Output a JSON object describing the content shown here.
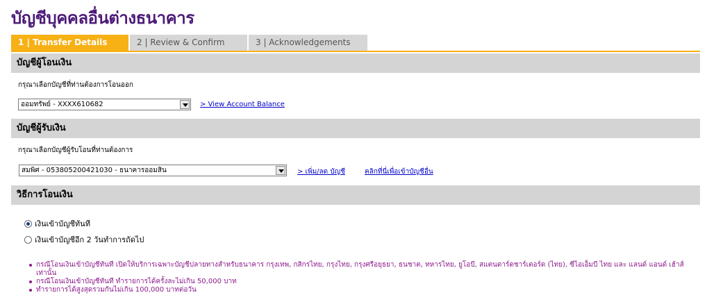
{
  "page": {
    "title": "บัญชีบุคคลอื่นต่างธนาคาร"
  },
  "tabs": [
    {
      "label": "1 | Transfer Details"
    },
    {
      "label": "2 | Review & Confirm"
    },
    {
      "label": "3 | Acknowledgements"
    }
  ],
  "from_account": {
    "header": "บัญชีผู้โอนเงิน",
    "instruction": "กรุณาเลือกบัญชีที่ท่านต้องการโอนออก",
    "selected": "ออมทรัพย์ - XXXX610682",
    "balance_link": "> View Account Balance"
  },
  "to_account": {
    "header": "บัญชีผู้รับเงิน",
    "instruction": "กรุณาเลือกบัญชีผู้รับโอนที่ท่านต้องการ",
    "selected": "สมพิศ - 053805200421030 - ธนาคารออมสิน",
    "add_remove_link": "> เพิ่ม/ลด บัญชี",
    "click_link": "คลิกที่นี่เพื่อเข้าบัญชีอื่น"
  },
  "method": {
    "header": "วิธีการโอนเงิน",
    "options": [
      {
        "label": "เงินเข้าบัญชีทันที",
        "checked": true
      },
      {
        "label": "เงินเข้าบัญชีอีก 2 วันทำการถัดไป",
        "checked": false
      }
    ]
  },
  "notes": [
    "กรณีโอนเงินเข้าบัญชีทันที เปิดให้บริการเฉพาะบัญชีปลายทางสำหรับธนาคาร กรุงเทพ, กสิกรไทย, กรุงไทย, กรุงศรีอยุธยา, ธนชาต, ทหารไทย, ยูโอบี, สแตนดาร์ดชาร์เตอร์ด (ไทย), ซีไอเอ็มบี ไทย และ แลนด์ แอนด์ เฮ้าส์ เท่านั้น",
    "กรณีโอนเงินเข้าบัญชีทันที ทำรายการได้ครั้งละไม่เกิน 50,000 บาท",
    "ทำรายการได้สูงสุดรวมกันไม่เกิน 100,000 บาทต่อวัน"
  ],
  "colors": {
    "title": "#4b1a78",
    "tab_active": "#f7b115",
    "note_text": "#8b1a8b",
    "link": "#0000cc"
  }
}
